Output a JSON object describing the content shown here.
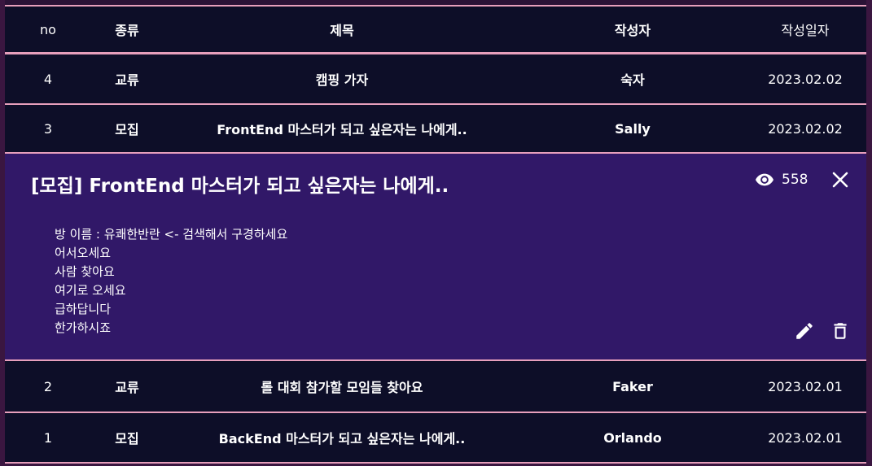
{
  "table": {
    "headers": {
      "no": "no",
      "kind": "종류",
      "title": "제목",
      "author": "작성자",
      "date": "작성일자"
    },
    "rows_top": [
      {
        "no": "4",
        "kind": "교류",
        "title": "캠핑 가자",
        "author": "숙자",
        "date": "2023.02.02"
      },
      {
        "no": "3",
        "kind": "모집",
        "title": "FrontEnd 마스터가 되고 싶은자는 나에게..",
        "author": "Sally",
        "date": "2023.02.02"
      }
    ],
    "rows_bottom": [
      {
        "no": "2",
        "kind": "교류",
        "title": "롤 대회 참가할 모임들 찾아요",
        "author": "Faker",
        "date": "2023.02.01"
      },
      {
        "no": "1",
        "kind": "모집",
        "title": "BackEnd 마스터가 되고 싶은자는 나에게..",
        "author": "Orlando",
        "date": "2023.02.01"
      }
    ]
  },
  "detail": {
    "title": "[모집] FrontEnd 마스터가 되고 싶은자는 나에게..",
    "views": "558",
    "body_lines": [
      "방 이름 : 유쾌한반란 <- 검색해서 구경하세요",
      "어서오세요",
      "사람 찾아요",
      "여기로 오세요",
      "급하답니다",
      "한가하시죠"
    ],
    "icons": {
      "views": "eye-icon",
      "close": "close-icon",
      "edit": "pencil-icon",
      "delete": "trash-icon"
    }
  },
  "colors": {
    "row_bg": "#0d0e28",
    "detail_bg": "#311868",
    "separator": "#e79fbc",
    "page_bg": "#3a1640"
  }
}
